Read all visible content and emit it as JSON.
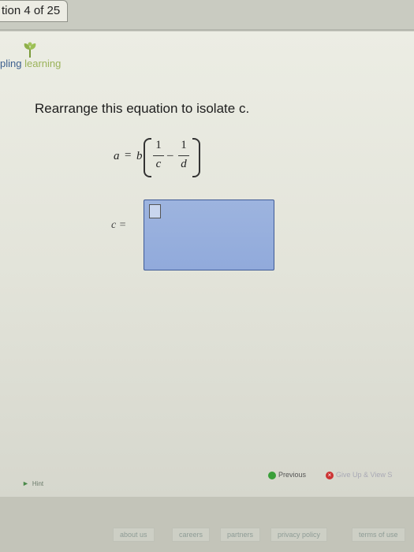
{
  "tab": {
    "label": "tion 4 of 25"
  },
  "logo": {
    "part1": "pling",
    "part2": "learning"
  },
  "question": {
    "prompt": "Rearrange this equation to isolate c.",
    "equation": {
      "lhs": "a",
      "eq": "=",
      "coef": "b",
      "frac1_num": "1",
      "frac1_den": "c",
      "minus": "–",
      "frac2_num": "1",
      "frac2_den": "d"
    },
    "answer_label": "c ="
  },
  "nav": {
    "previous": "Previous",
    "give_up": "Give Up & View S"
  },
  "hint": {
    "label": "Hint"
  },
  "footer": {
    "links": [
      "about us",
      "careers",
      "partners",
      "privacy policy",
      "terms of use"
    ]
  }
}
